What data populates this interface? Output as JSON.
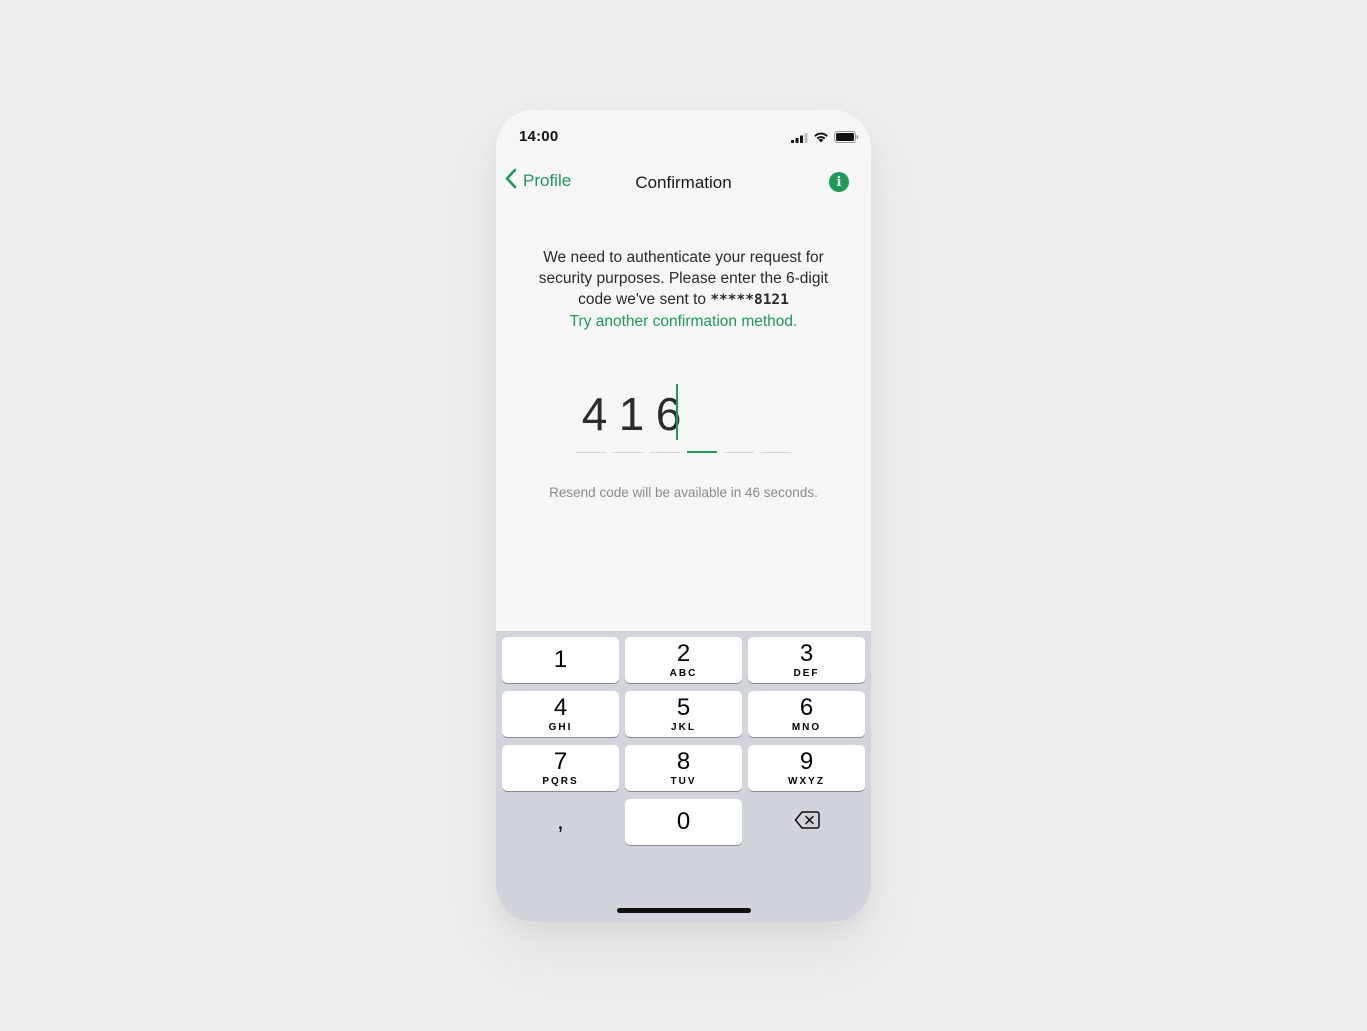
{
  "status_bar": {
    "time": "14:00"
  },
  "nav": {
    "back_label": "Profile",
    "title": "Confirmation",
    "info_glyph": "i"
  },
  "message": {
    "text": "We need to authenticate your request for security purposes. Please enter the 6-digit code we've sent to",
    "masked_phone": "*****8121",
    "alt_method_link": "Try another confirmation method."
  },
  "code": {
    "digits": [
      "4",
      "1",
      "6"
    ],
    "length": 6,
    "active_slot_index": 3
  },
  "resend": {
    "text": "Resend code will be available in 46 seconds."
  },
  "keyboard": {
    "keys": [
      {
        "num": "1",
        "letters": ""
      },
      {
        "num": "2",
        "letters": "ABC"
      },
      {
        "num": "3",
        "letters": "DEF"
      },
      {
        "num": "4",
        "letters": "GHI"
      },
      {
        "num": "5",
        "letters": "JKL"
      },
      {
        "num": "6",
        "letters": "MNO"
      },
      {
        "num": "7",
        "letters": "PQRS"
      },
      {
        "num": "8",
        "letters": "TUV"
      },
      {
        "num": "9",
        "letters": "WXYZ"
      },
      {
        "num": ",",
        "letters": ""
      },
      {
        "num": "0",
        "letters": ""
      }
    ],
    "delete_icon": "backspace-icon"
  },
  "colors": {
    "accent": "#1e9a5a",
    "background": "#f6f6f6",
    "keyboard_bg": "#d1d4da"
  }
}
